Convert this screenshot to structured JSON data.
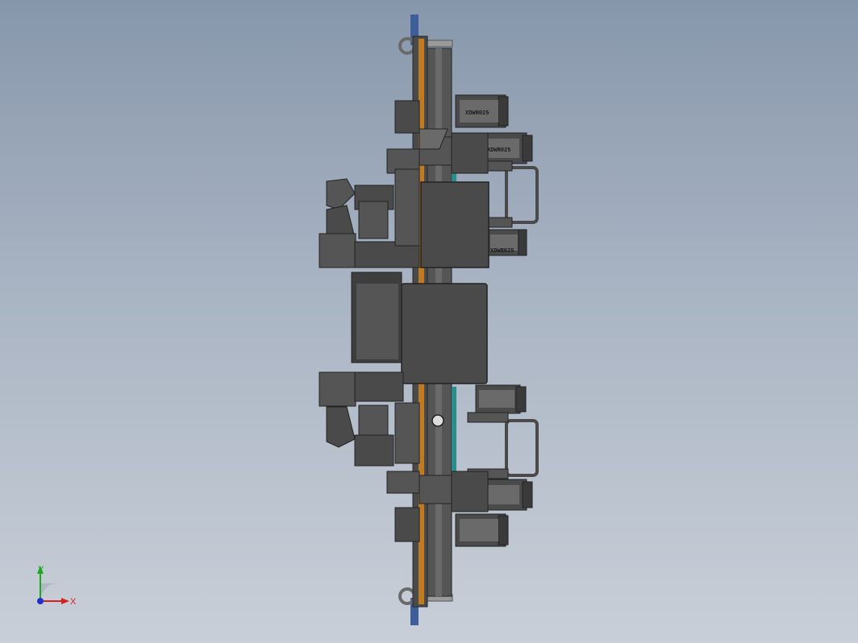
{
  "viewport": {
    "background_top": "#8797ab",
    "background_bottom": "#c9cfd8"
  },
  "model": {
    "body_color": "#4a4a4a",
    "dark_color": "#2e2e2e",
    "light_color": "#6a6a6a",
    "orange_strip_color": "#c07a22",
    "teal_strip_color": "#2a8c8c",
    "blue_tab_color": "#3d5e99",
    "cylinder_stamp_top": "XDWR025",
    "cylinder_stamp_mid": "XDWR025",
    "cylinder_stamp_low": "XDWR025"
  },
  "triad": {
    "x_label": "X",
    "y_label": "Y",
    "x_color": "#d62020",
    "y_color": "#1fa81f",
    "z_color": "#2030c8"
  }
}
